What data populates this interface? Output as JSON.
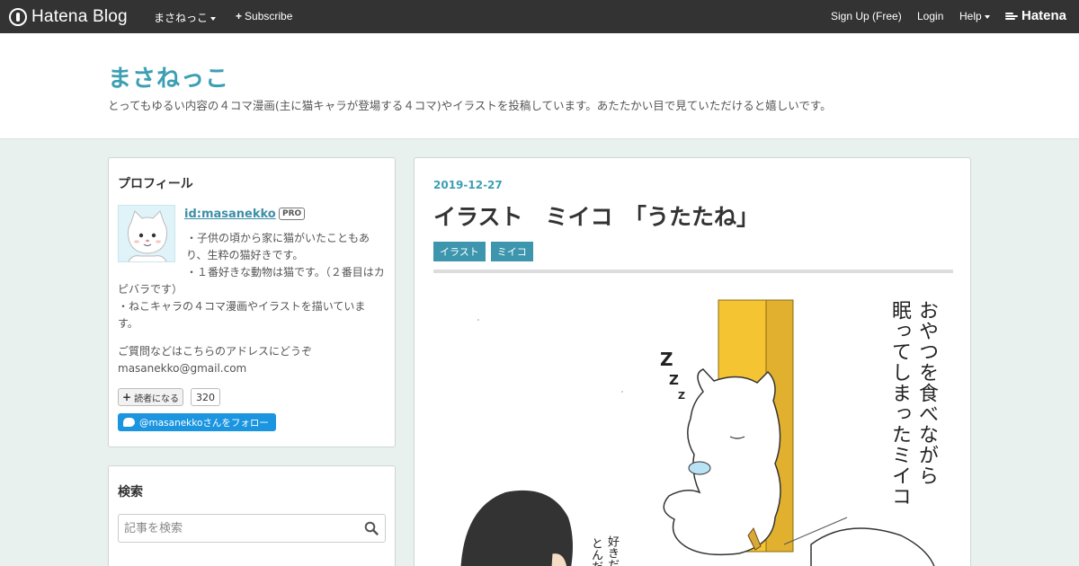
{
  "globalbar": {
    "logo_text": "Hatena Blog",
    "blog_menu_label": "まさねっこ",
    "subscribe_label": "Subscribe",
    "signup_label": "Sign Up (Free)",
    "login_label": "Login",
    "help_label": "Help",
    "hatena_label": "Hatena"
  },
  "blog": {
    "title": "まさねっこ",
    "description": "とってもゆるい内容の４コマ漫画(主に猫キャラが登場する４コマ)やイラストを投稿しています。あたたかい目で見ていただけると嬉しいです。"
  },
  "profile": {
    "title": "プロフィール",
    "id": "id:masanekko",
    "pro_badge": "PRO",
    "lines": [
      "・子供の頃から家に猫がいたこともあり、生粋の猫好きです。",
      "・１番好きな動物は猫です。（２番目はカピバラです）",
      "・ねこキャラの４コマ漫画やイラストを描いています。"
    ],
    "contact": "ご質問などはこちらのアドレスにどうぞ",
    "email": "masanekko@gmail.com",
    "follow_label": "読者になる",
    "follow_count": "320",
    "twitter_label": "@masanekkoさんをフォロー"
  },
  "search": {
    "title": "検索",
    "placeholder": "記事を検索"
  },
  "article": {
    "date": "2019-12-27",
    "title": "イラスト　ミイコ　「うたたね」",
    "tags": [
      "イラスト",
      "ミイコ"
    ],
    "caption_line1": "おやつを食べながら",
    "caption_line2": "眠ってしまったミイコ",
    "side_line1": "好きだ",
    "side_line2": "とんだ"
  },
  "colors": {
    "accent": "#3d9fb3",
    "tag_bg": "#3d96ad",
    "page_bg": "#e8f1ee",
    "twitter": "#1b95e0"
  }
}
